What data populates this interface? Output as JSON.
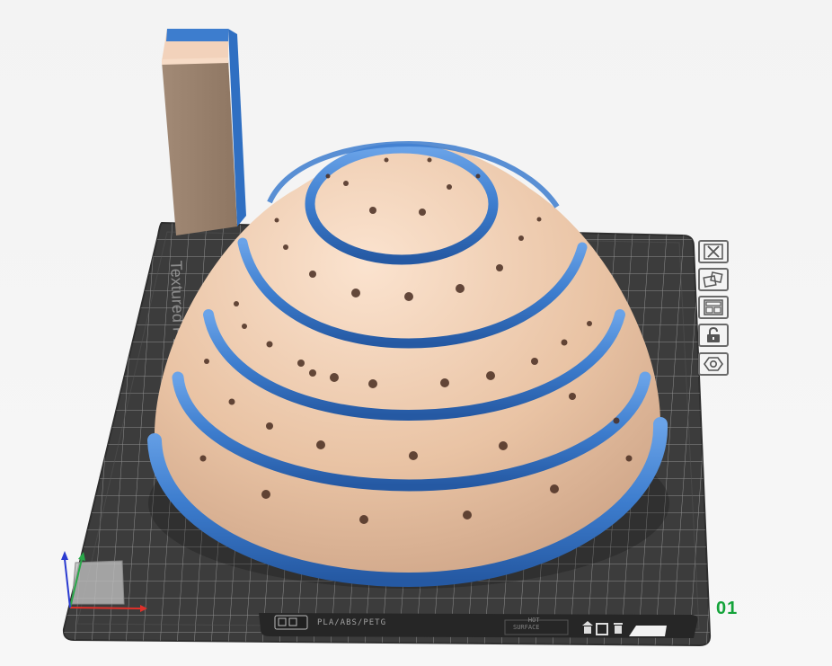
{
  "plate": {
    "number": "01",
    "plate_name_vertical": "Textured PEI Plate",
    "filament_label": "PLA/ABS/PETG",
    "bottom_small_text_line1": "HOT",
    "bottom_small_text_line2": "SURFACE"
  },
  "toolbar": {
    "buttons": [
      {
        "name": "close-plate",
        "icon": "close-icon"
      },
      {
        "name": "arrange-plate",
        "icon": "arrange-icon"
      },
      {
        "name": "plate-settings",
        "icon": "plate-layout-icon"
      },
      {
        "name": "lock-plate",
        "icon": "lock-icon"
      },
      {
        "name": "plate-filament-settings",
        "icon": "hexagon-icon"
      }
    ]
  },
  "colors": {
    "model_body": "#e8c6a8",
    "model_ring": "#3d7dce",
    "bed": "#3c3c3c",
    "grid_line": "#9a9a9a",
    "plate_number": "#14a33a",
    "axis_x": "#e0302a",
    "axis_y": "#2aa84a",
    "axis_z": "#2a3bd0"
  }
}
